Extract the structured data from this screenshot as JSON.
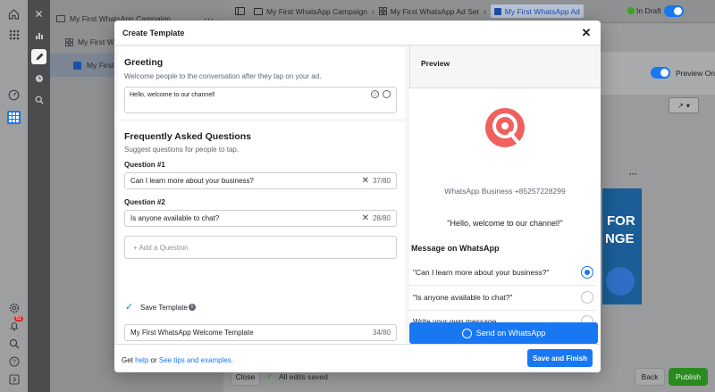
{
  "rail_icons": [
    "home-icon",
    "grid-icon",
    "dashboard-icon",
    "table-icon",
    "settings-icon",
    "notification-icon",
    "search-icon",
    "help-icon",
    "logout-icon"
  ],
  "notification_badge": "51",
  "tree": {
    "campaign": "My First WhatsApp Campaign",
    "adset": "My First W",
    "ad": "My First W"
  },
  "breadcrumb": {
    "campaign": "My First WhatsApp Campaign",
    "adset": "My First WhatsApp Ad Set",
    "ad": "My First WhatsApp Ad"
  },
  "status": "In Draft",
  "preview_on_label": "Preview On",
  "bottom": {
    "close": "Close",
    "saved": "All edits saved",
    "back": "Back",
    "publish": "Publish"
  },
  "modal": {
    "title": "Create Template",
    "greeting": {
      "title": "Greeting",
      "desc": "Welcome people to the conversation after they tap on your ad.",
      "text": "Hello, welcome to our channel!"
    },
    "faq": {
      "title": "Frequently Asked Questions",
      "desc": "Suggest questions for people to tap.",
      "q1_label": "Question #1",
      "q1_value": "Can I learn more about your business?",
      "q1_count": "37/80",
      "q2_label": "Question #2",
      "q2_value": "Is anyone available to chat?",
      "q2_count": "28/80",
      "add": "+ Add a Question"
    },
    "save_template": {
      "label": "Save Template",
      "name": "My First WhatsApp Welcome Template",
      "count": "34/80"
    },
    "preview": {
      "title": "Preview",
      "business": "WhatsApp Business +85257228299",
      "greeting": "\"Hello, welcome to our channel!\"",
      "message_title": "Message on WhatsApp",
      "options": [
        "\"Can I learn more about your business?\"",
        "\"Is anyone available to chat?\"",
        "Write your own message"
      ],
      "send": "Send on WhatsApp"
    },
    "footer": {
      "get": "Get",
      "help": "help",
      "or": "or",
      "tips": "See tips and examples.",
      "save_finish": "Save and Finish"
    }
  },
  "bg_ad": {
    "text1": "FOR",
    "text2": "NGE"
  },
  "colors": {
    "accent": "#1877f2",
    "logo": "#f0605d",
    "publish": "#42b72a"
  }
}
